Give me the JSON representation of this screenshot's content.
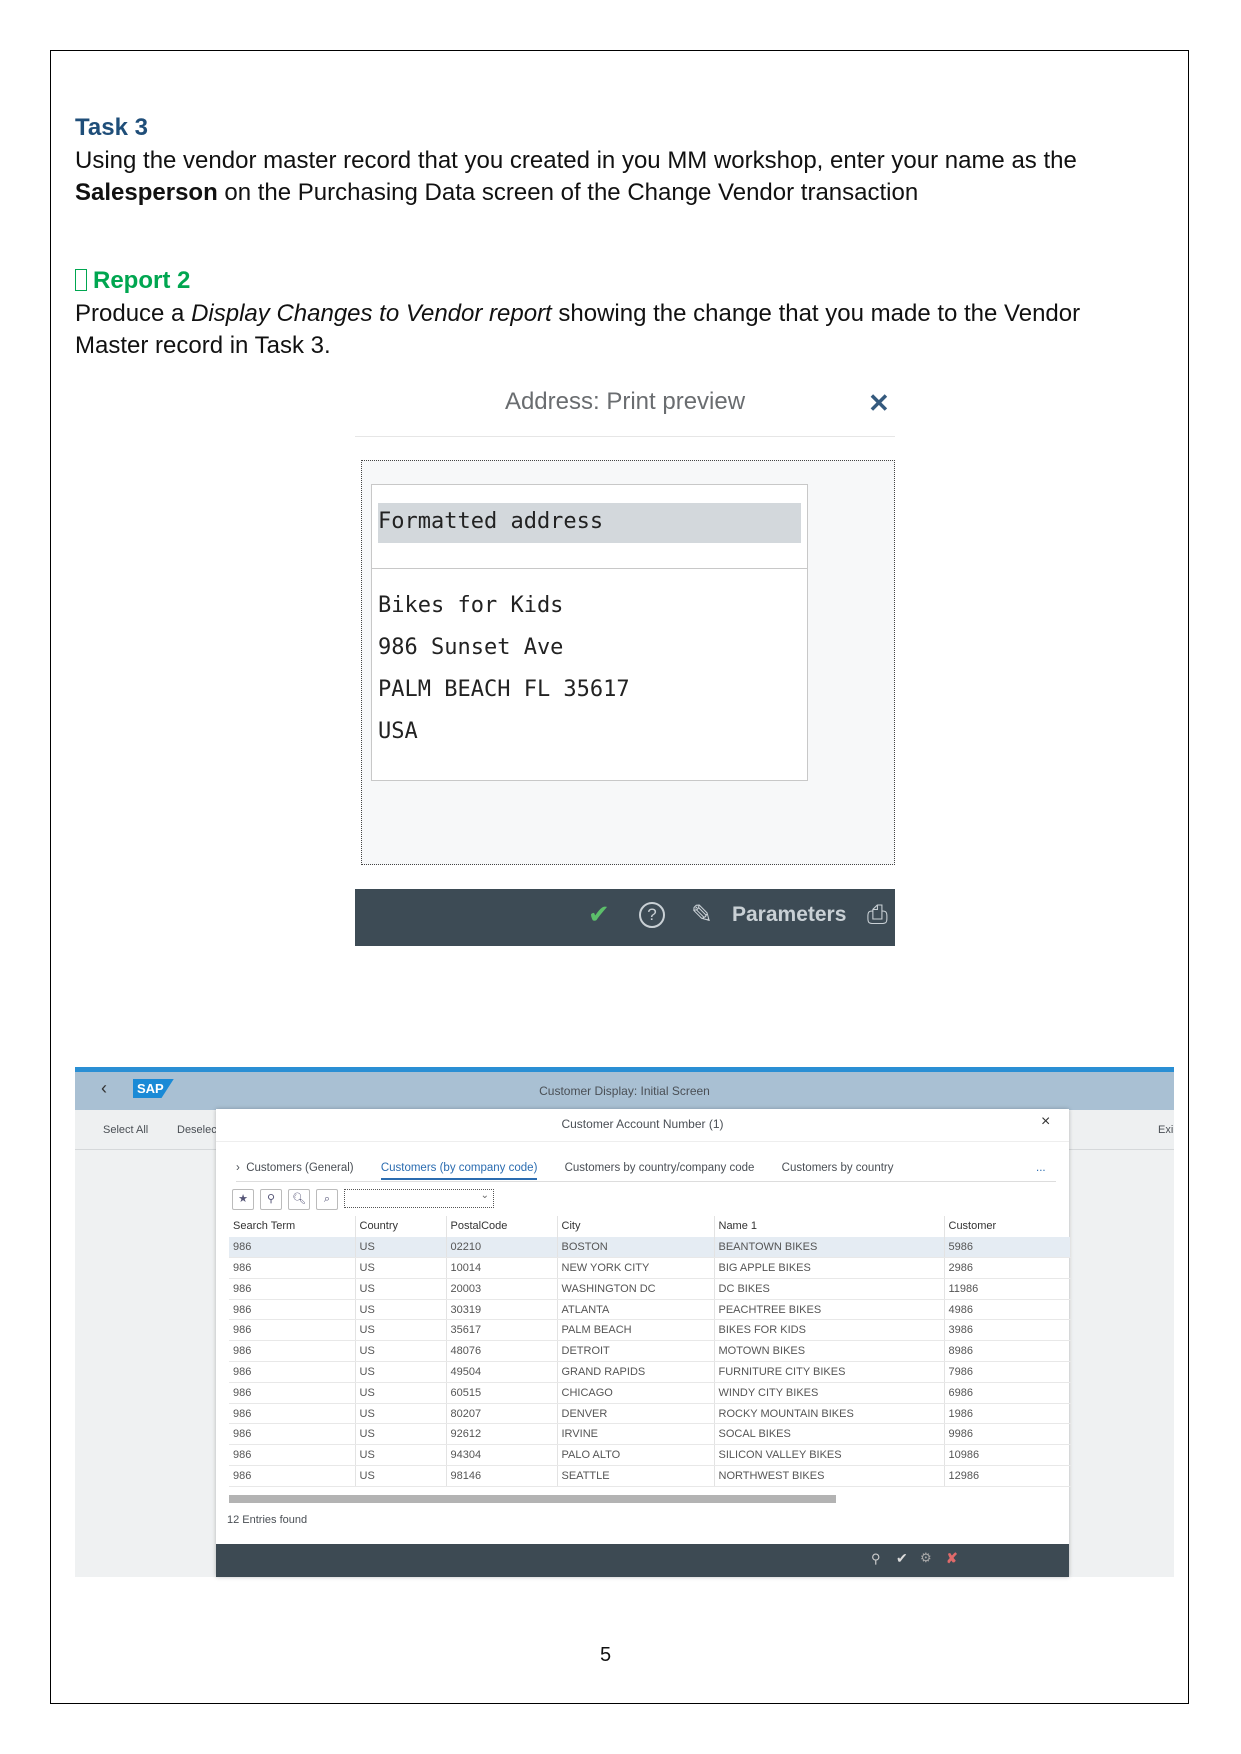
{
  "task": {
    "heading": "Task 3",
    "line1": "Using the vendor master record that you created in you MM workshop, enter your name as the",
    "bold": "Salesperson",
    "line2": " on the Purchasing Data screen of the Change Vendor transaction"
  },
  "report": {
    "bullet": "",
    "heading": "Report 2",
    "pre": "Produce a ",
    "italic": "Display Changes to Vendor report",
    "post": " showing the change that you made to the Vendor",
    "line2": "Master record in Task 3."
  },
  "print_preview": {
    "title": "Address: Print preview",
    "close": "✕",
    "section": "Formatted address",
    "lines": [
      "Bikes for Kids",
      "986 Sunset Ave",
      "PALM BEACH FL  35617",
      "USA"
    ],
    "buttons": {
      "ok": "✔",
      "help": "?",
      "edit": "✎",
      "parameters": "Parameters",
      "print": "⎙"
    },
    "colors": {
      "bar": "#3d4b55",
      "ok": "#5cbf6a"
    }
  },
  "sap": {
    "logo": "SAP",
    "title": "Customer Display: Initial Screen",
    "select_all": "Select All",
    "deselect": "Deselec",
    "exit": "Exi",
    "popup": {
      "title": "Customer Account Number (1)",
      "close": "×",
      "tabs": [
        "Customers (General)",
        "Customers (by company code)",
        "Customers by country/company code",
        "Customers by country"
      ],
      "more": "...",
      "columns": [
        "Search Term",
        "Country",
        "PostalCode",
        "City",
        "Name 1",
        "Customer"
      ],
      "rows": [
        [
          "986",
          "US",
          "02210",
          "BOSTON",
          "BEANTOWN BIKES",
          "5986"
        ],
        [
          "986",
          "US",
          "10014",
          "NEW YORK CITY",
          "BIG APPLE BIKES",
          "2986"
        ],
        [
          "986",
          "US",
          "20003",
          "WASHINGTON DC",
          "DC BIKES",
          "11986"
        ],
        [
          "986",
          "US",
          "30319",
          "ATLANTA",
          "PEACHTREE BIKES",
          "4986"
        ],
        [
          "986",
          "US",
          "35617",
          "PALM BEACH",
          "BIKES FOR KIDS",
          "3986"
        ],
        [
          "986",
          "US",
          "48076",
          "DETROIT",
          "MOTOWN BIKES",
          "8986"
        ],
        [
          "986",
          "US",
          "49504",
          "GRAND RAPIDS",
          "FURNITURE CITY BIKES",
          "7986"
        ],
        [
          "986",
          "US",
          "60515",
          "CHICAGO",
          "WINDY CITY BIKES",
          "6986"
        ],
        [
          "986",
          "US",
          "80207",
          "DENVER",
          "ROCKY MOUNTAIN BIKES",
          "1986"
        ],
        [
          "986",
          "US",
          "92612",
          "IRVINE",
          "SOCAL BIKES",
          "9986"
        ],
        [
          "986",
          "US",
          "94304",
          "PALO ALTO",
          "SILICON VALLEY BIKES",
          "10986"
        ],
        [
          "986",
          "US",
          "98146",
          "SEATTLE",
          "NORTHWEST BIKES",
          "12986"
        ]
      ],
      "entries": "12 Entries found"
    }
  },
  "page_number": "5"
}
